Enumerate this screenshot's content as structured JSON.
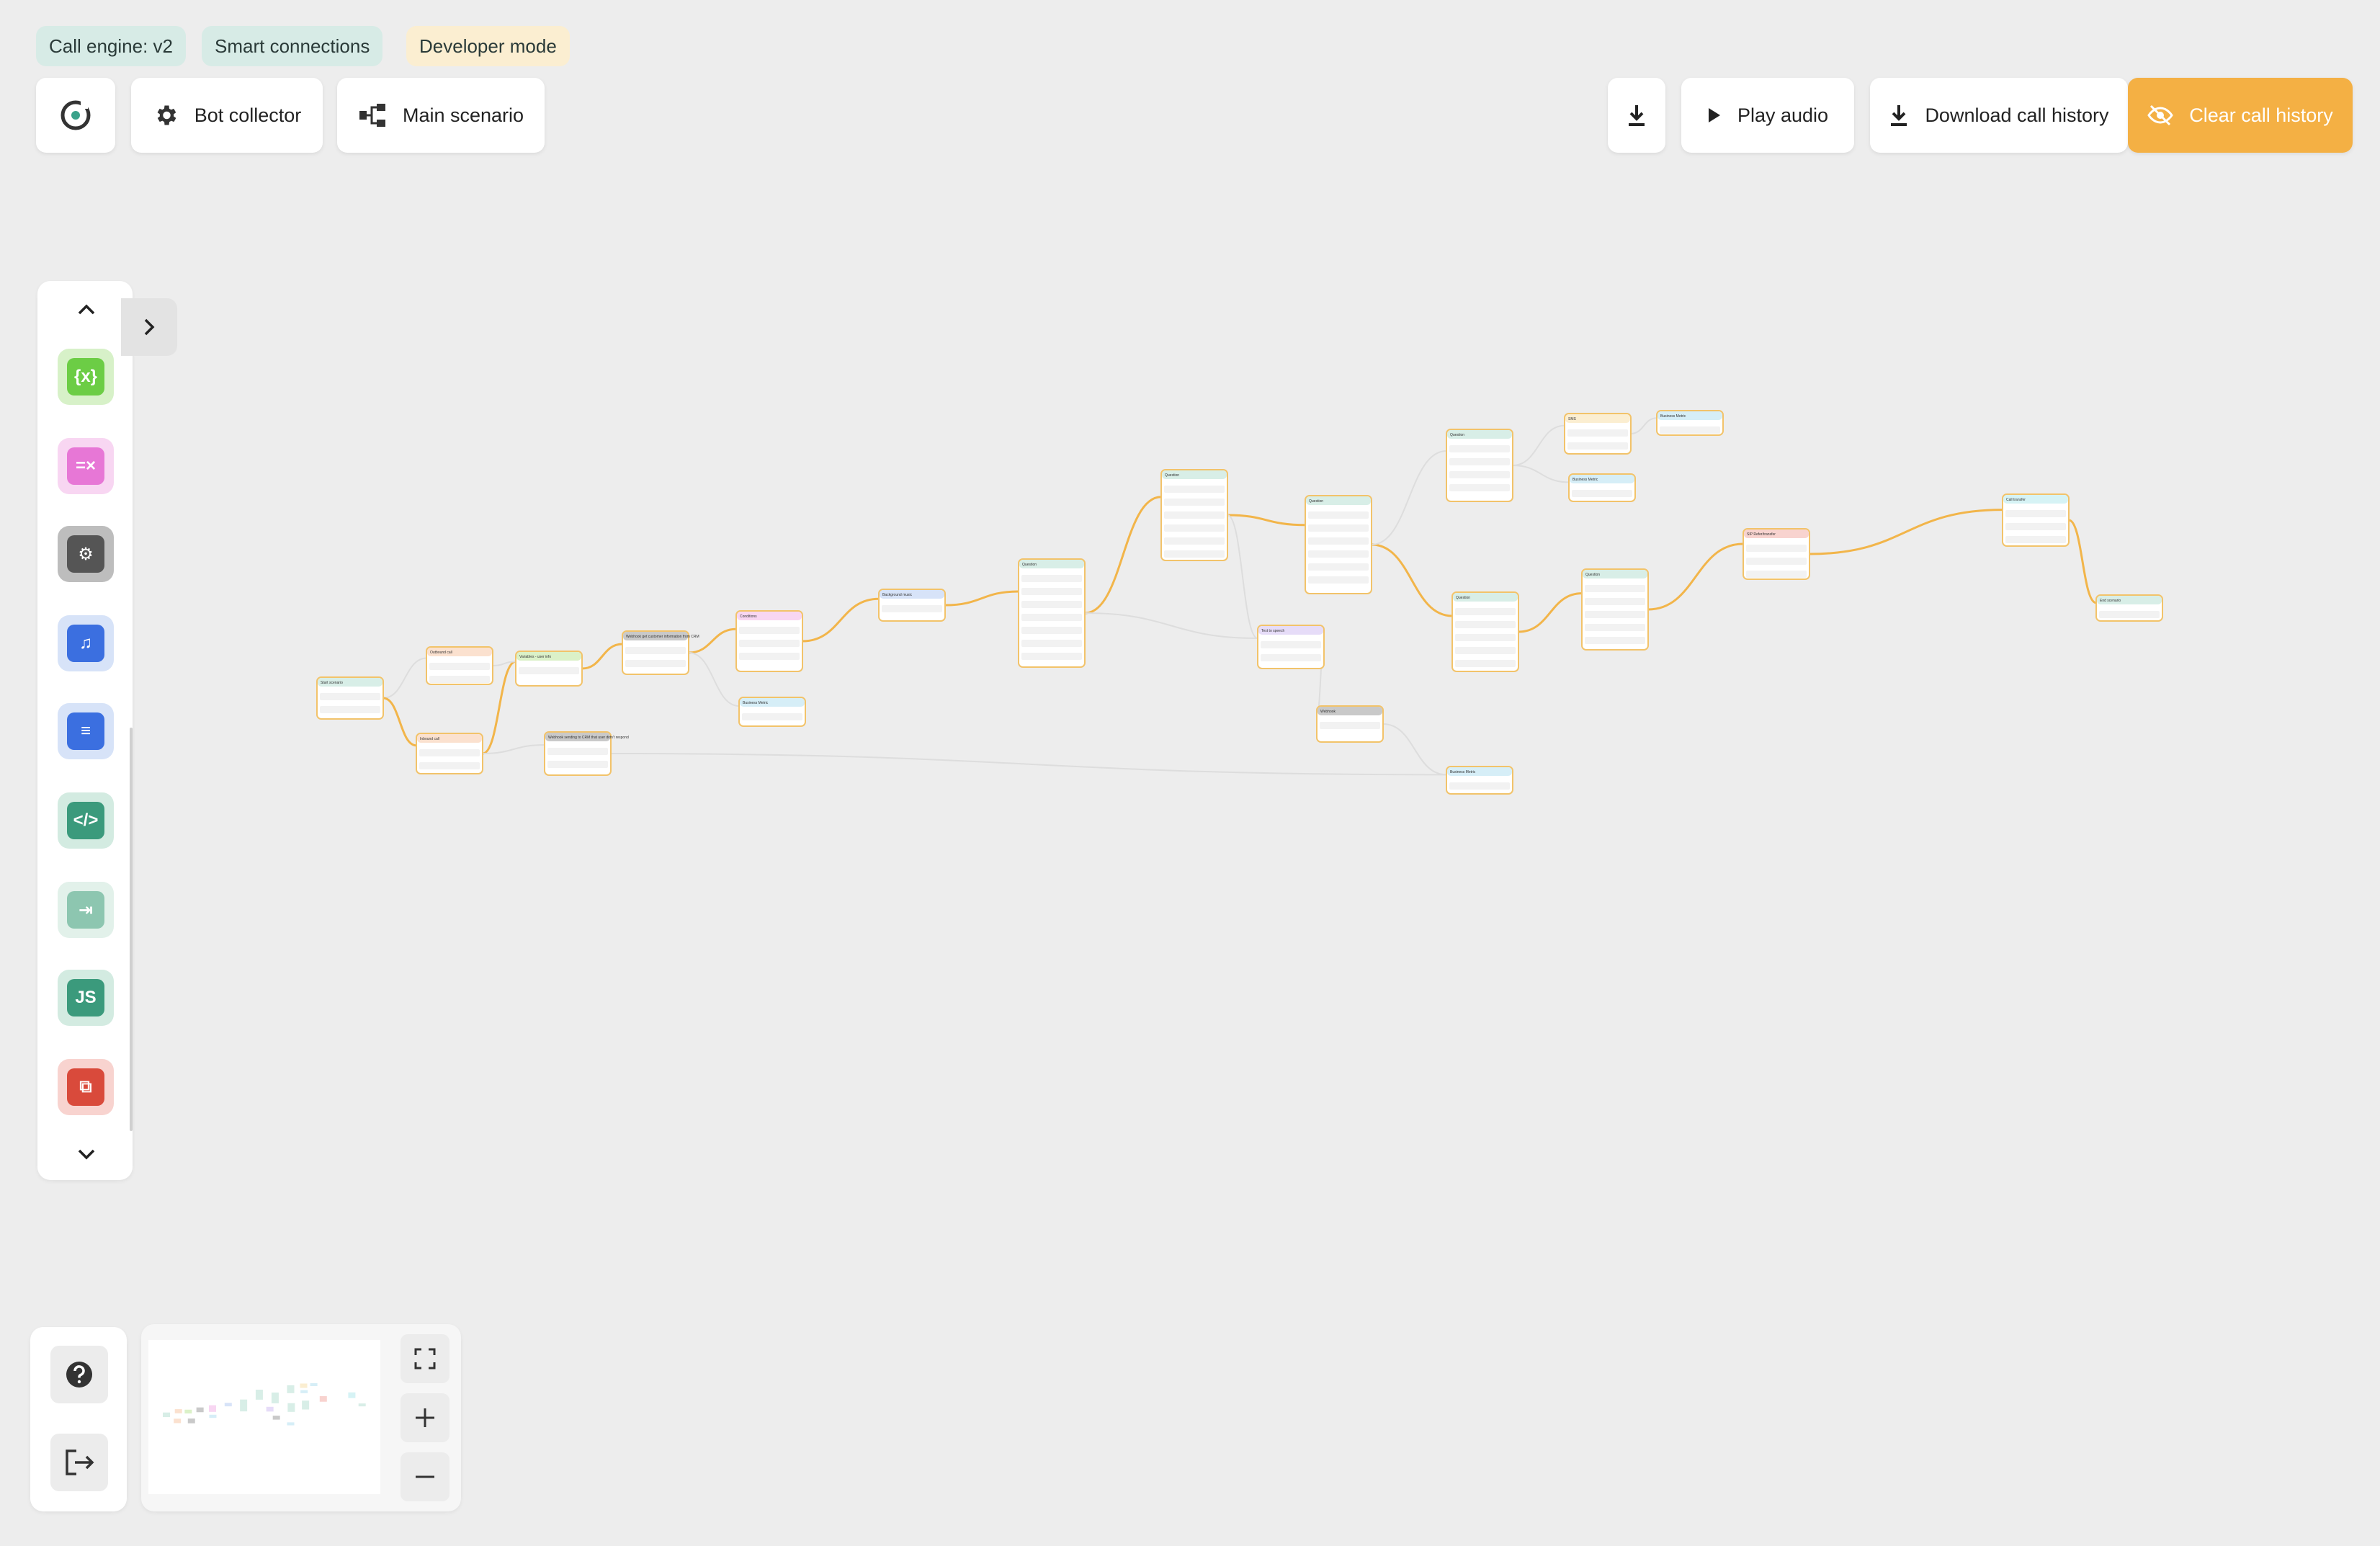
{
  "tags": {
    "call_engine": "Call engine: v2",
    "smart_connections": "Smart connections",
    "developer_mode": "Developer mode"
  },
  "toolbar": {
    "bot_collector": "Bot collector",
    "main_scenario": "Main scenario",
    "play_audio": "Play audio",
    "download_call_history": "Download call history",
    "clear_call_history": "Clear call history"
  },
  "colors": {
    "accent_orange": "#f4b044",
    "edge_orange": "#f2b54a",
    "tag_green": "#d7ebe6",
    "tag_yellow": "#fbeed1",
    "canvas_bg": "#ededed"
  },
  "sidebar": {
    "tools": [
      {
        "icon": "variable-icon",
        "bg": "#d7f1c8",
        "fg": "#6ccd45",
        "glyph": "{x}"
      },
      {
        "icon": "compare-icon",
        "bg": "#f8d6f2",
        "fg": "#e777d6",
        "glyph": "=×"
      },
      {
        "icon": "webhook-icon",
        "bg": "#bdbdbd",
        "fg": "#555555",
        "glyph": "⚙"
      },
      {
        "icon": "audio-icon",
        "bg": "#d7e3f8",
        "fg": "#3b6fe0",
        "glyph": "♫"
      },
      {
        "icon": "speech-icon",
        "bg": "#d7e3f8",
        "fg": "#3b6fe0",
        "glyph": "≡"
      },
      {
        "icon": "code-icon",
        "bg": "#d3ebe1",
        "fg": "#3b9a7c",
        "glyph": "</>"
      },
      {
        "icon": "transfer-icon",
        "bg": "#e2f1ea",
        "fg": "#8dc6b0",
        "glyph": "⇥"
      },
      {
        "icon": "javascript-icon",
        "bg": "#d3ebe1",
        "fg": "#3b9a7c",
        "glyph": "JS"
      },
      {
        "icon": "scenario-icon",
        "bg": "#f8d3cf",
        "fg": "#d94a3b",
        "glyph": "⧉"
      }
    ]
  },
  "flow": {
    "nodes": [
      {
        "t": "Start scenario",
        "c": "#d8eee7"
      },
      {
        "t": "Outbound call",
        "c": "#fbe1cf"
      },
      {
        "t": "Inbound call",
        "c": "#fbe1cf"
      },
      {
        "t": "Variables - user info",
        "c": "#dbf1c8"
      },
      {
        "t": "Webhook get customer information from CRM",
        "c": "#c9c9c9"
      },
      {
        "t": "Webhook sending to CRM that user didn't respond",
        "c": "#c9c9c9"
      },
      {
        "t": "Conditions",
        "c": "#f8d6f2"
      },
      {
        "t": "Business Metric",
        "c": "#d6eef7"
      },
      {
        "t": "Background music",
        "c": "#d7e3f8"
      },
      {
        "t": "Question",
        "c": "#d8eee7"
      },
      {
        "t": "Question",
        "c": "#d8eee7"
      },
      {
        "t": "Text to speech",
        "c": "#e6dcf8"
      },
      {
        "t": "Question",
        "c": "#d8eee7"
      },
      {
        "t": "Webhook",
        "c": "#c9c9c9"
      },
      {
        "t": "Question",
        "c": "#d8eee7"
      },
      {
        "t": "Business Metric",
        "c": "#d6eef7"
      },
      {
        "t": "Question",
        "c": "#d8eee7"
      },
      {
        "t": "SMS",
        "c": "#fbeed1"
      },
      {
        "t": "Business Metric",
        "c": "#d6eef7"
      },
      {
        "t": "Business Metric",
        "c": "#d6eef7"
      },
      {
        "t": "Question",
        "c": "#d8eee7"
      },
      {
        "t": "SIP Refer/transfer",
        "c": "#f8d3cf"
      },
      {
        "t": "Call transfer",
        "c": "#d6f3f5"
      },
      {
        "t": "End scenario",
        "c": "#d8eee7"
      }
    ]
  }
}
